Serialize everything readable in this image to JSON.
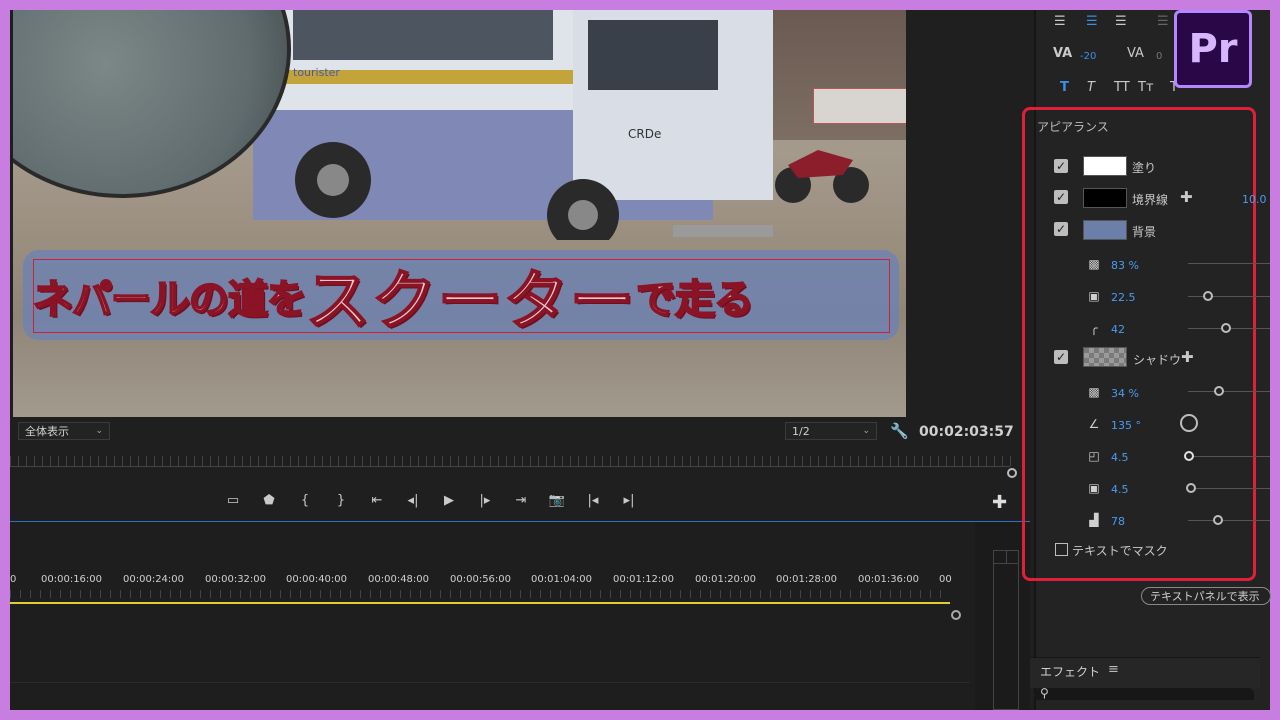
{
  "app": {
    "logo": "Pr"
  },
  "monitor": {
    "caption": {
      "part1": "ネパールの道を",
      "part2": "スクーター",
      "part3": "で走る"
    },
    "zoom": "全体表示",
    "resolution": "1/2",
    "timecode": "00:02:03:57",
    "bus_text": {
      "brand": "tourister",
      "model": "CRDe"
    }
  },
  "transport": [
    "mark-in-frame-icon",
    "marker-icon",
    "mark-in-icon",
    "mark-out-icon",
    "go-to-in-icon",
    "step-back-icon",
    "play-icon",
    "step-forward-icon",
    "go-to-out-icon",
    "export-frame-icon",
    "lift-icon",
    "extract-icon"
  ],
  "timeline": {
    "ruler": [
      "0",
      "00:00:16:00",
      "00:00:24:00",
      "00:00:32:00",
      "00:00:40:00",
      "00:00:48:00",
      "00:00:56:00",
      "00:01:04:00",
      "00:01:12:00",
      "00:01:20:00",
      "00:01:28:00",
      "00:01:36:00",
      "00"
    ]
  },
  "text_tools": {
    "tracking": "-20",
    "kerning": "0",
    "styles": [
      "T",
      "T",
      "TT",
      "Tт",
      "T"
    ]
  },
  "appearance": {
    "title": "アピアランス",
    "fill": {
      "label": "塗り",
      "color": "#ffffff"
    },
    "stroke": {
      "label": "境界線",
      "color": "#000000",
      "width": "10.0"
    },
    "background": {
      "label": "背景",
      "color": "#6b7fa8",
      "opacity": "83 %",
      "size": "22.5",
      "corner": "42"
    },
    "shadow": {
      "label": "シャドウ",
      "opacity": "34 %",
      "angle": "135 °",
      "distance": "4.5",
      "size": "4.5",
      "blur": "78"
    },
    "mask_label": "テキストでマスク"
  },
  "panel_button": "テキストパネルで表示",
  "effects": {
    "title": "エフェクト"
  },
  "colors": {
    "accent": "#3d8ee6",
    "highlight": "#e0203a",
    "border": "#c77ee0",
    "playhead": "#e0cf2a"
  }
}
